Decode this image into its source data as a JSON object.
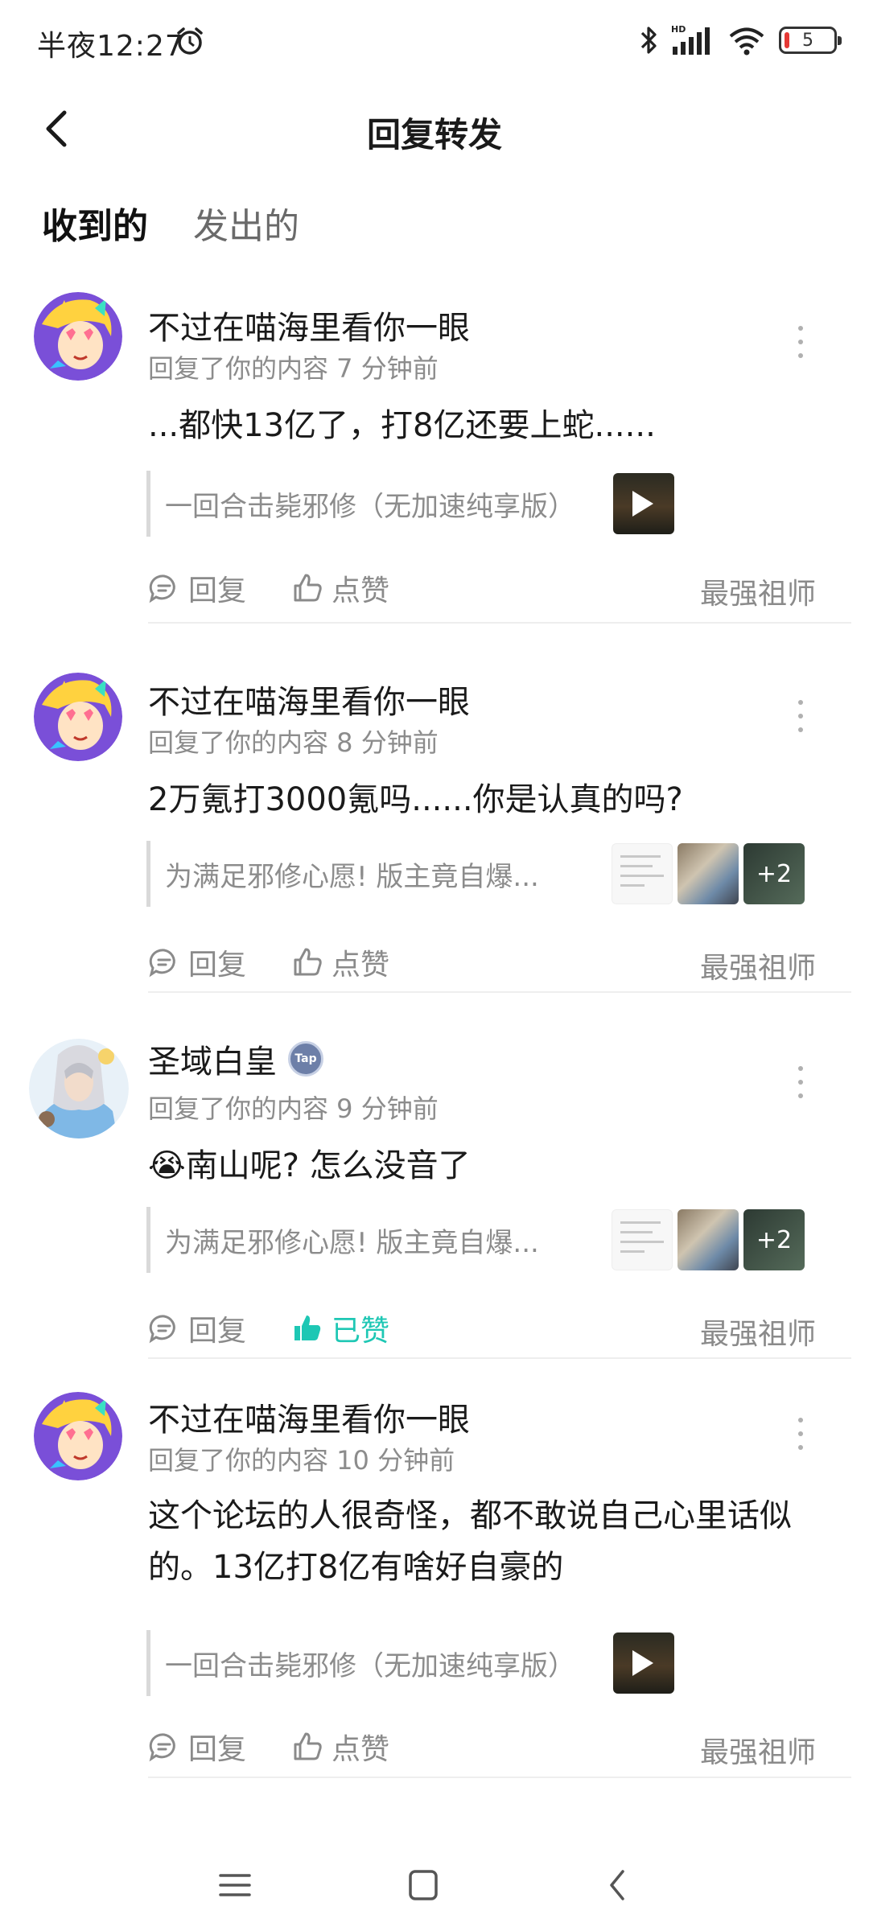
{
  "status": {
    "time": "半夜12:27",
    "battery": "5",
    "hd": "HD"
  },
  "header": {
    "title": "回复转发"
  },
  "tabs": [
    {
      "label": "收到的"
    },
    {
      "label": "发出的"
    }
  ],
  "items": [
    {
      "user": "不过在喵海里看你一眼",
      "meta": "回复了你的内容 7 分钟前",
      "content": "...都快13亿了，打8亿还要上蛇......",
      "quote": "一回合击毙邪修（无加速纯享版）",
      "reply": "回复",
      "like": "点赞",
      "forum": "最强祖师"
    },
    {
      "user": "不过在喵海里看你一眼",
      "meta": "回复了你的内容 8 分钟前",
      "content": "2万氪打3000氪吗......你是认真的吗?",
      "quote": "为满足邪修心愿! 版主竟自爆...",
      "more_count": "+2",
      "reply": "回复",
      "like": "点赞",
      "forum": "最强祖师"
    },
    {
      "user": "圣域白皇",
      "badge": "Tap",
      "meta": "回复了你的内容 9 分钟前",
      "content": "😭南山呢? 怎么没音了",
      "quote": "为满足邪修心愿! 版主竟自爆...",
      "more_count": "+2",
      "reply": "回复",
      "like": "已赞",
      "forum": "最强祖师"
    },
    {
      "user": "不过在喵海里看你一眼",
      "meta": "回复了你的内容 10 分钟前",
      "content": "这个论坛的人很奇怪，都不敢说自己心里话似的。13亿打8亿有啥好自豪的",
      "quote": "一回合击毙邪修（无加速纯享版）",
      "reply": "回复",
      "like": "点赞",
      "forum": "最强祖师"
    }
  ],
  "colors": {
    "accent": "#27c8b6",
    "liked": "#1ec7b4",
    "muted": "#8c8c8c"
  }
}
